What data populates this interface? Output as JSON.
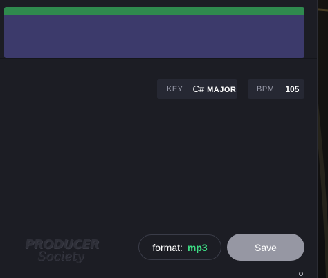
{
  "key": {
    "label": "KEY",
    "note": "C#",
    "mode": "MAJOR"
  },
  "bpm": {
    "label": "BPM",
    "value": "105"
  },
  "format": {
    "label": "format:",
    "value": "mp3"
  },
  "save_label": "Save",
  "logo": {
    "line1": "PRODUCER",
    "line2": "Society"
  },
  "colors": {
    "card": "#3c3a6b",
    "stripe": "#2f8a4e",
    "format_value": "#3ddc84",
    "save_button": "#9697a3",
    "panel": "#1c1d24"
  }
}
